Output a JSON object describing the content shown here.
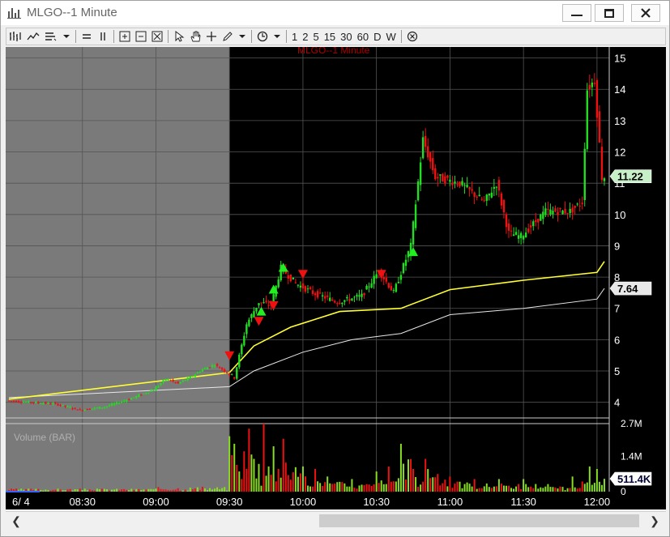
{
  "window": {
    "title": "MLGO--1 Minute"
  },
  "toolbar": {
    "intervals": [
      "1",
      "2",
      "5",
      "15",
      "30",
      "60",
      "D",
      "W"
    ]
  },
  "chart": {
    "watermark": "MLGO--1 Minute",
    "volume_label": "Volume (BAR)",
    "date_label": "6/ 4",
    "last_price": "11.22",
    "ma_value": "7.64",
    "last_volume": "511.4K",
    "x_ticks": [
      "08:30",
      "09:00",
      "09:30",
      "10:00",
      "10:30",
      "11:00",
      "11:30",
      "12:00"
    ],
    "y_ticks": [
      "15",
      "14",
      "13",
      "12",
      "11",
      "10",
      "9",
      "8",
      "7",
      "6",
      "5",
      "4"
    ],
    "vol_ticks": [
      "2.7M",
      "1.4M",
      "0"
    ],
    "colors": {
      "up": "#22dd22",
      "down": "#ee1111",
      "ma_fast": "#ffff33",
      "ma_slow": "#e8e8e8",
      "premarket_bg": "#7a7a7a",
      "grid": "#555555"
    }
  },
  "chart_data": {
    "type": "candlestick",
    "title": "MLGO--1 Minute",
    "xlabel": "",
    "ylabel": "",
    "ylim": [
      3.5,
      15.3
    ],
    "x_range": [
      "08:00",
      "12:05"
    ],
    "volume_ylim": [
      0,
      2.7
    ],
    "volume_unit": "M",
    "price_path": [
      [
        "08:00",
        4.05
      ],
      [
        "08:10",
        4.0
      ],
      [
        "08:20",
        3.95
      ],
      [
        "08:30",
        3.75
      ],
      [
        "08:40",
        3.85
      ],
      [
        "08:50",
        4.1
      ],
      [
        "09:00",
        4.4
      ],
      [
        "09:05",
        4.75
      ],
      [
        "09:10",
        4.6
      ],
      [
        "09:15",
        4.8
      ],
      [
        "09:20",
        5.05
      ],
      [
        "09:25",
        5.2
      ],
      [
        "09:30",
        4.95
      ],
      [
        "09:33",
        4.8
      ],
      [
        "09:38",
        6.5
      ],
      [
        "09:43",
        7.2
      ],
      [
        "09:48",
        7.1
      ],
      [
        "09:52",
        8.3
      ],
      [
        "09:58",
        7.8
      ],
      [
        "10:05",
        7.5
      ],
      [
        "10:15",
        7.2
      ],
      [
        "10:25",
        7.4
      ],
      [
        "10:32",
        8.2
      ],
      [
        "10:38",
        7.5
      ],
      [
        "10:45",
        9.0
      ],
      [
        "10:50",
        12.4
      ],
      [
        "10:55",
        11.2
      ],
      [
        "11:05",
        11.0
      ],
      [
        "11:15",
        10.4
      ],
      [
        "11:20",
        11.0
      ],
      [
        "11:25",
        9.4
      ],
      [
        "11:30",
        9.3
      ],
      [
        "11:40",
        10.1
      ],
      [
        "11:50",
        10.1
      ],
      [
        "11:55",
        10.4
      ],
      [
        "11:57",
        14.0
      ],
      [
        "12:00",
        14.3
      ],
      [
        "12:03",
        11.2
      ]
    ],
    "ma_fast": [
      [
        "08:00",
        4.1
      ],
      [
        "09:30",
        4.95
      ],
      [
        "09:40",
        5.8
      ],
      [
        "09:55",
        6.4
      ],
      [
        "10:15",
        6.9
      ],
      [
        "10:40",
        7.0
      ],
      [
        "11:00",
        7.6
      ],
      [
        "11:30",
        7.9
      ],
      [
        "12:00",
        8.15
      ],
      [
        "12:03",
        8.5
      ]
    ],
    "ma_slow": [
      [
        "08:00",
        4.15
      ],
      [
        "09:30",
        4.5
      ],
      [
        "09:40",
        5.0
      ],
      [
        "10:00",
        5.6
      ],
      [
        "10:20",
        6.0
      ],
      [
        "10:40",
        6.2
      ],
      [
        "11:00",
        6.8
      ],
      [
        "11:30",
        7.0
      ],
      [
        "12:00",
        7.3
      ],
      [
        "12:03",
        7.64
      ]
    ],
    "buy_signals": [
      [
        "09:43",
        6.9
      ],
      [
        "09:48",
        7.6
      ],
      [
        "09:52",
        8.3
      ],
      [
        "10:45",
        8.8
      ]
    ],
    "sell_signals": [
      [
        "09:30",
        5.5
      ],
      [
        "09:42",
        6.6
      ],
      [
        "09:48",
        7.1
      ],
      [
        "10:00",
        8.1
      ],
      [
        "10:32",
        8.1
      ]
    ],
    "volume_bars_m": [
      [
        "09:30",
        2.2
      ],
      [
        "09:32",
        1.9
      ],
      [
        "09:34",
        0.8
      ],
      [
        "09:36",
        1.6
      ],
      [
        "09:38",
        2.5
      ],
      [
        "09:40",
        1.3
      ],
      [
        "09:42",
        1.1
      ],
      [
        "09:44",
        2.7
      ],
      [
        "09:46",
        1.0
      ],
      [
        "09:48",
        1.8
      ],
      [
        "09:50",
        0.9
      ],
      [
        "09:52",
        2.1
      ],
      [
        "10:00",
        1.0
      ],
      [
        "10:05",
        0.9
      ],
      [
        "10:10",
        0.6
      ],
      [
        "10:20",
        0.5
      ],
      [
        "10:30",
        0.8
      ],
      [
        "10:35",
        1.0
      ],
      [
        "10:40",
        1.9
      ],
      [
        "10:45",
        0.9
      ],
      [
        "10:50",
        1.3
      ],
      [
        "10:55",
        0.7
      ],
      [
        "11:00",
        0.6
      ],
      [
        "11:10",
        0.5
      ],
      [
        "11:20",
        0.5
      ],
      [
        "11:30",
        0.5
      ],
      [
        "11:40",
        0.3
      ],
      [
        "11:50",
        0.6
      ],
      [
        "11:57",
        1.0
      ],
      [
        "12:00",
        0.9
      ],
      [
        "12:03",
        0.51
      ]
    ],
    "last_price": 11.22,
    "ma_last": 7.64,
    "last_volume": "511.4K",
    "grid": true
  }
}
